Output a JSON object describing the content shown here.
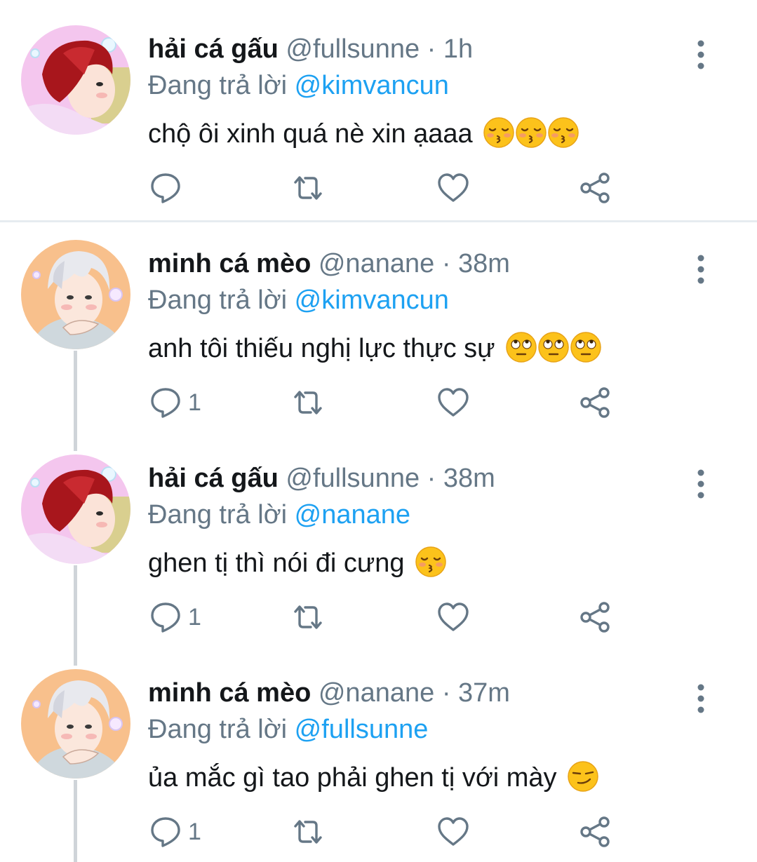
{
  "colors": {
    "text": "#14171a",
    "secondary": "#657786",
    "link": "#1da1f2",
    "thread_line": "#cfd4d9"
  },
  "labels": {
    "replying_prefix": "Đang trả lời",
    "separator": "·"
  },
  "tweets": [
    {
      "author_name": "hải cá gấu",
      "author_handle": "@fullsunne",
      "time": "1h",
      "replying_to": "@kimvancun",
      "text": "chộ ôi xinh quá nè xin ạaaa",
      "emojis": [
        "kissing-face-closed-eyes-emoji",
        "kissing-face-closed-eyes-emoji",
        "kissing-face-closed-eyes-emoji"
      ],
      "reply_count": "",
      "avatar": "red-hair-avatar"
    },
    {
      "author_name": "minh cá mèo",
      "author_handle": "@nanane",
      "time": "38m",
      "replying_to": "@kimvancun",
      "text": "anh tôi thiếu nghị lực thực sự",
      "emojis": [
        "eye-roll-emoji",
        "eye-roll-emoji",
        "eye-roll-emoji"
      ],
      "reply_count": "1",
      "avatar": "white-hair-avatar"
    },
    {
      "author_name": "hải cá gấu",
      "author_handle": "@fullsunne",
      "time": "38m",
      "replying_to": "@nanane",
      "text": "ghen tị thì nói đi cưng",
      "emojis": [
        "kissing-face-closed-eyes-emoji"
      ],
      "reply_count": "1",
      "avatar": "red-hair-avatar"
    },
    {
      "author_name": "minh cá mèo",
      "author_handle": "@nanane",
      "time": "37m",
      "replying_to": "@fullsunne",
      "text": "ủa mắc gì tao phải ghen tị với mày",
      "emojis": [
        "smirk-emoji"
      ],
      "reply_count": "1",
      "avatar": "white-hair-avatar"
    }
  ]
}
